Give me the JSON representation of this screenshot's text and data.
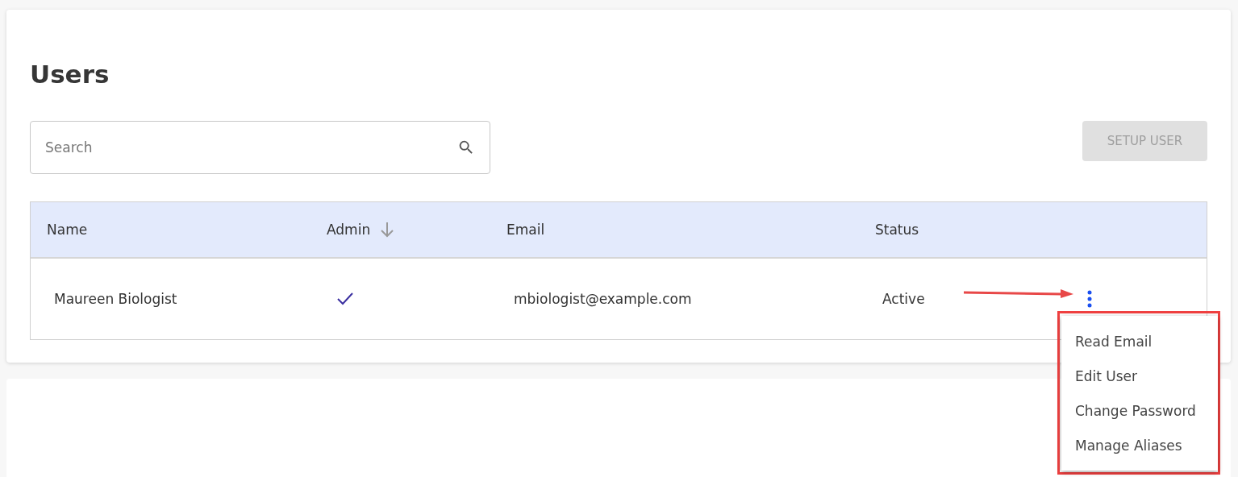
{
  "title": "Users",
  "search": {
    "placeholder": "Search"
  },
  "setup_button": {
    "label": "SETUP USER",
    "disabled": true
  },
  "table": {
    "columns": [
      {
        "label": "Name",
        "sorted": false
      },
      {
        "label": "Admin",
        "sorted": true
      },
      {
        "label": "Email",
        "sorted": false
      },
      {
        "label": "Status",
        "sorted": false
      }
    ],
    "rows": [
      {
        "name": "Maureen Biologist",
        "admin": true,
        "email": "mbiologist@example.com",
        "status": "Active"
      }
    ]
  },
  "row_menu": {
    "items": [
      "Read Email",
      "Edit User",
      "Change Password",
      "Manage Aliases"
    ]
  }
}
